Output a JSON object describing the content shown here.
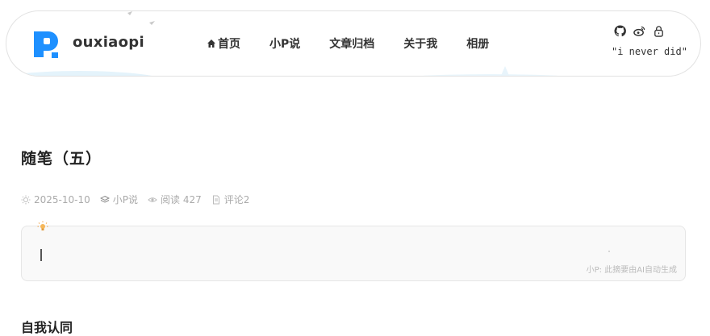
{
  "header": {
    "brand": "ouxiaopi",
    "nav": [
      {
        "label": "首页",
        "icon": "home-icon"
      },
      {
        "label": "小P说"
      },
      {
        "label": "文章归档"
      },
      {
        "label": "关于我"
      },
      {
        "label": "相册"
      }
    ],
    "social_icons": [
      "github-icon",
      "weibo-icon",
      "lock-icon"
    ],
    "motto": "\"i never did\""
  },
  "article": {
    "title": "随笔（五）",
    "meta": {
      "date": "2025-10-10",
      "category": "小P说",
      "reads": "阅读 427",
      "comments": "评论2"
    },
    "summary": {
      "content": "",
      "ai_note": "小P: 此摘要由AI自动生成"
    },
    "section_heading": "自我认同"
  },
  "colors": {
    "brand_blue": "#1e90ff",
    "text_dark": "#222222",
    "meta_gray": "#aaaaaa",
    "summary_bg": "#f9f9f9"
  }
}
